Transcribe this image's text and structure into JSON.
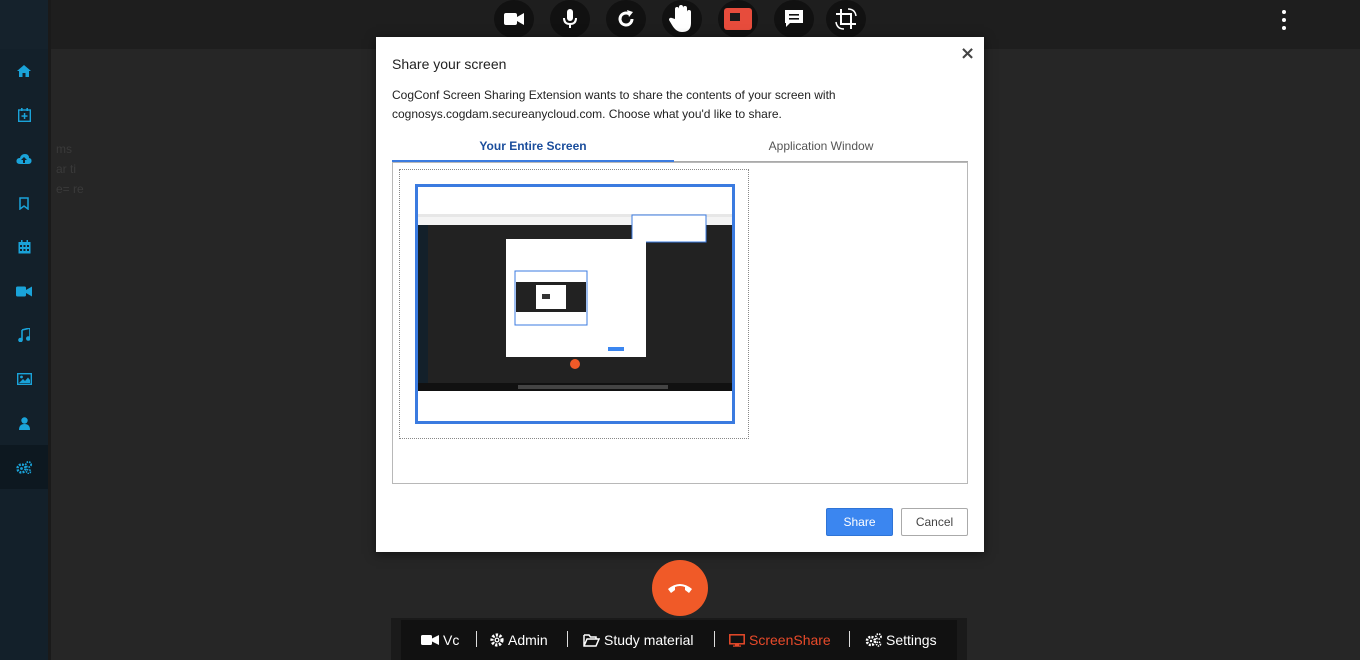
{
  "toolbar": {
    "buttons": [
      {
        "name": "video-camera-icon"
      },
      {
        "name": "microphone-icon"
      },
      {
        "name": "refresh-icon"
      },
      {
        "name": "raise-hand-icon"
      },
      {
        "name": "screen-share-icon",
        "color": "#e74c3c"
      },
      {
        "name": "chat-icon"
      },
      {
        "name": "crop-rotate-icon"
      }
    ],
    "more_icon": "more-vertical-icon"
  },
  "sidebar": {
    "items": [
      {
        "icon": "home-icon"
      },
      {
        "icon": "calendar-add-icon"
      },
      {
        "icon": "cloud-upload-icon"
      },
      {
        "icon": "bookmark-icon"
      },
      {
        "icon": "calendar-icon"
      },
      {
        "icon": "video-icon"
      },
      {
        "icon": "music-icon"
      },
      {
        "icon": "image-icon"
      },
      {
        "icon": "user-icon"
      },
      {
        "icon": "cogs-icon",
        "active": true
      }
    ],
    "accent": "#1aa3d9"
  },
  "background_text": [
    "ms",
    "ar ti",
    "e= re"
  ],
  "dialog": {
    "title": "Share your screen",
    "close": "×",
    "description": "CogConf Screen Sharing Extension wants to share the contents of your screen with cognosys.cogdam.secureanycloud.com. Choose what you'd like to share.",
    "tabs": [
      {
        "label": "Your Entire Screen",
        "active": true
      },
      {
        "label": "Application Window",
        "active": false
      }
    ],
    "share_label": "Share",
    "cancel_label": "Cancel",
    "accent": "#3b86f0"
  },
  "bottom_nav": {
    "items": [
      {
        "label": "Vc",
        "icon": "video-camera-icon"
      },
      {
        "label": "Admin",
        "icon": "gear-icon"
      },
      {
        "label": "Study material",
        "icon": "folder-open-icon"
      },
      {
        "label": "ScreenShare",
        "icon": "monitor-icon",
        "active": true
      },
      {
        "label": "Settings",
        "icon": "cogs-icon"
      }
    ],
    "active_color": "#e84a2a"
  },
  "hangup_icon": "phone-hangup-icon",
  "hangup_color": "#f05a28"
}
